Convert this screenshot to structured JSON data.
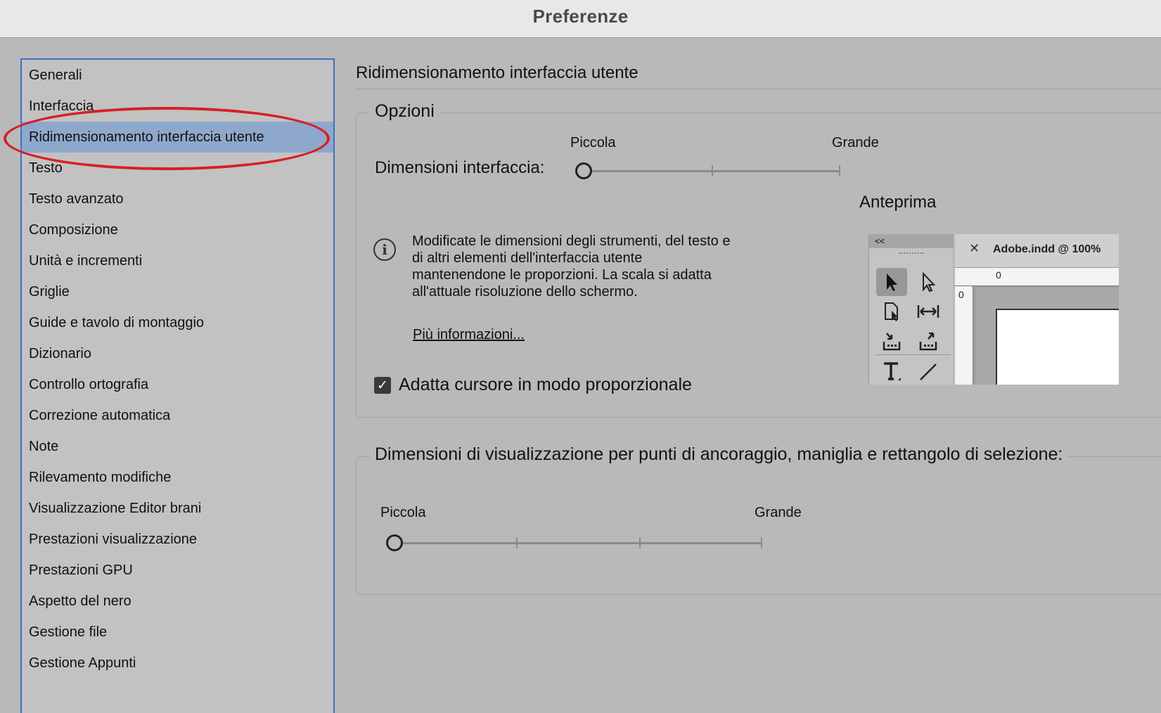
{
  "window": {
    "title": "Preferenze"
  },
  "sidebar": {
    "items": [
      {
        "label": "Generali"
      },
      {
        "label": "Interfaccia"
      },
      {
        "label": "Ridimensionamento interfaccia utente"
      },
      {
        "label": "Testo"
      },
      {
        "label": "Testo avanzato"
      },
      {
        "label": "Composizione"
      },
      {
        "label": "Unità e incrementi"
      },
      {
        "label": "Griglie"
      },
      {
        "label": "Guide e tavolo di montaggio"
      },
      {
        "label": "Dizionario"
      },
      {
        "label": "Controllo ortografia"
      },
      {
        "label": "Correzione automatica"
      },
      {
        "label": "Note"
      },
      {
        "label": "Rilevamento modifiche"
      },
      {
        "label": "Visualizzazione Editor brani"
      },
      {
        "label": "Prestazioni visualizzazione"
      },
      {
        "label": "Prestazioni GPU"
      },
      {
        "label": "Aspetto del nero"
      },
      {
        "label": "Gestione file"
      },
      {
        "label": "Gestione Appunti"
      }
    ],
    "selected_index": 2,
    "highlight_color": "#d81e24"
  },
  "main": {
    "section_title": "Ridimensionamento interfaccia utente",
    "options": {
      "legend": "Opzioni",
      "interface_size": {
        "label": "Dimensioni interfaccia:",
        "min_label": "Piccola",
        "max_label": "Grande",
        "ticks": 3,
        "value_fraction": 0
      },
      "preview": {
        "title": "Anteprima",
        "panel_collapse": "<<",
        "doc_close": "✕",
        "doc_name": "Adobe.indd @ 100%",
        "ruler_h_zero": "0",
        "ruler_v_zero": "0"
      },
      "info": {
        "text": "Modificate le dimensioni degli strumenti, del testo e di altri elementi dell'interfaccia utente mantenendone le proporzioni. La scala si adatta all'attuale risoluzione dello schermo.",
        "link": "Più informazioni..."
      },
      "scale_cursor": {
        "label": "Adatta cursore in modo proporzionale",
        "checked": true
      }
    },
    "anchor_size": {
      "legend": "Dimensioni di visualizzazione per punti di ancoraggio, maniglia e rettangolo di selezione:",
      "min_label": "Piccola",
      "max_label": "Grande",
      "ticks": 4,
      "value_fraction": 0
    }
  }
}
